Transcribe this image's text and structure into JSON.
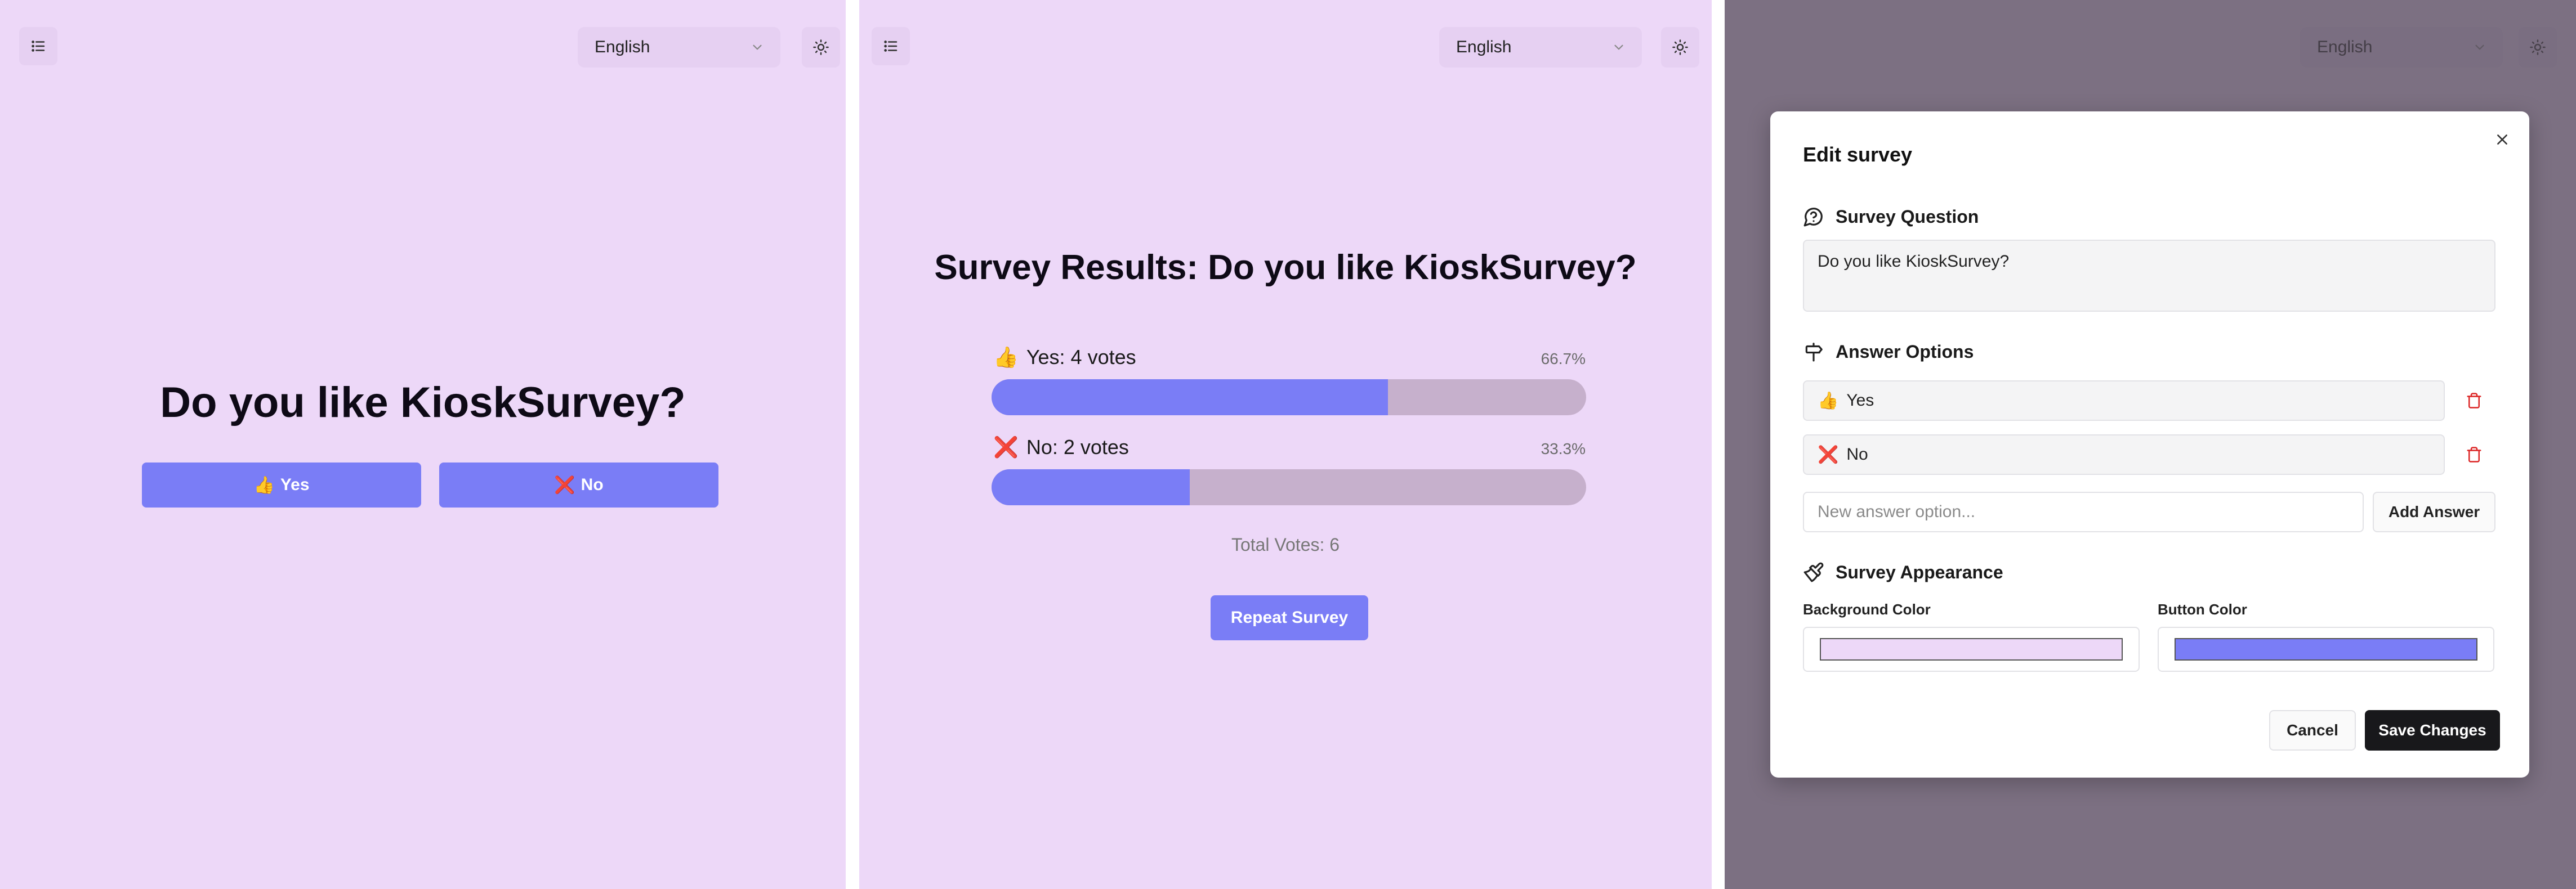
{
  "header": {
    "language": "English"
  },
  "survey": {
    "question": "Do you like KioskSurvey?",
    "answers": [
      {
        "emoji": "👍",
        "label": "Yes"
      },
      {
        "emoji": "❌",
        "label": "No"
      }
    ]
  },
  "results": {
    "title": "Survey Results: Do you like KioskSurvey?",
    "items": [
      {
        "emoji": "👍",
        "text": "Yes: 4 votes",
        "percent_text": "66.7%",
        "percent": 66.7
      },
      {
        "emoji": "❌",
        "text": "No: 2 votes",
        "percent_text": "33.3%",
        "percent": 33.3
      }
    ],
    "total": "Total Votes: 6",
    "repeat_label": "Repeat Survey"
  },
  "edit_modal": {
    "title": "Edit survey",
    "question_section": "Survey Question",
    "question_value": "Do you like KioskSurvey?",
    "answers_section": "Answer Options",
    "answer_options": [
      {
        "emoji": "👍",
        "label": "Yes"
      },
      {
        "emoji": "❌",
        "label": "No"
      }
    ],
    "new_answer_placeholder": "New answer option...",
    "add_answer_label": "Add Answer",
    "appearance_section": "Survey Appearance",
    "background_color_label": "Background Color",
    "button_color_label": "Button Color",
    "background_color": "#edd8f8",
    "button_color": "#7a7df6",
    "cancel_label": "Cancel",
    "save_label": "Save Changes"
  },
  "colors": {
    "page_bg": "#edd8f8",
    "accent": "#7a7df6",
    "track": "#c6b0cc",
    "danger": "#dc2626",
    "dark": "#18181b"
  },
  "icons": {
    "menu": "list-icon",
    "theme": "sun-icon",
    "dropdown": "chevron-down-icon",
    "close": "close-icon",
    "question": "message-circle-question-icon",
    "answers": "signpost-icon",
    "appearance": "paintbrush-icon",
    "delete": "trash-icon"
  }
}
